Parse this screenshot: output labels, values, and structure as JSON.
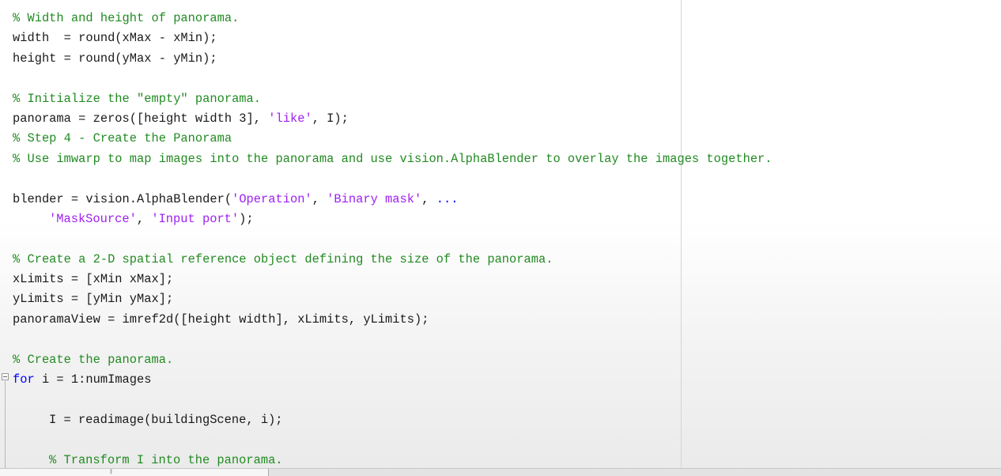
{
  "editor": {
    "lines": [
      {
        "indent": 0,
        "tokens": [
          {
            "t": "comment",
            "v": "% Width and height of panorama."
          }
        ]
      },
      {
        "indent": 0,
        "tokens": [
          {
            "t": "text",
            "v": "width  = round(xMax - xMin);"
          }
        ]
      },
      {
        "indent": 0,
        "tokens": [
          {
            "t": "text",
            "v": "height = round(yMax - yMin);"
          }
        ]
      },
      {
        "indent": 0,
        "tokens": []
      },
      {
        "indent": 0,
        "tokens": [
          {
            "t": "comment",
            "v": "% Initialize the \"empty\" panorama."
          }
        ]
      },
      {
        "indent": 0,
        "tokens": [
          {
            "t": "text",
            "v": "panorama = zeros([height width 3], "
          },
          {
            "t": "string",
            "v": "'like'"
          },
          {
            "t": "text",
            "v": ", I);"
          }
        ]
      },
      {
        "indent": 0,
        "tokens": [
          {
            "t": "comment",
            "v": "% Step 4 - Create the Panorama"
          }
        ]
      },
      {
        "indent": 0,
        "tokens": [
          {
            "t": "comment",
            "v": "% Use imwarp to map images into the panorama and use vision.AlphaBlender to overlay the images together."
          }
        ]
      },
      {
        "indent": 0,
        "tokens": []
      },
      {
        "indent": 0,
        "tokens": [
          {
            "t": "text",
            "v": "blender = vision.AlphaBlender("
          },
          {
            "t": "string",
            "v": "'Operation'"
          },
          {
            "t": "text",
            "v": ", "
          },
          {
            "t": "string",
            "v": "'Binary mask'"
          },
          {
            "t": "text",
            "v": ", "
          },
          {
            "t": "keyword",
            "v": "..."
          }
        ]
      },
      {
        "indent": 1,
        "tokens": [
          {
            "t": "string",
            "v": "'MaskSource'"
          },
          {
            "t": "text",
            "v": ", "
          },
          {
            "t": "string",
            "v": "'Input port'"
          },
          {
            "t": "text",
            "v": ");"
          }
        ]
      },
      {
        "indent": 0,
        "tokens": []
      },
      {
        "indent": 0,
        "tokens": [
          {
            "t": "comment",
            "v": "% Create a 2-D spatial reference object defining the size of the panorama."
          }
        ]
      },
      {
        "indent": 0,
        "tokens": [
          {
            "t": "text",
            "v": "xLimits = [xMin xMax];"
          }
        ]
      },
      {
        "indent": 0,
        "tokens": [
          {
            "t": "text",
            "v": "yLimits = [yMin yMax];"
          }
        ]
      },
      {
        "indent": 0,
        "tokens": [
          {
            "t": "text",
            "v": "panoramaView = imref2d([height width], xLimits, yLimits);"
          }
        ]
      },
      {
        "indent": 0,
        "tokens": []
      },
      {
        "indent": 0,
        "tokens": [
          {
            "t": "comment",
            "v": "% Create the panorama."
          }
        ]
      },
      {
        "indent": 0,
        "tokens": [
          {
            "t": "keyword",
            "v": "for"
          },
          {
            "t": "text",
            "v": " i = 1:numImages"
          }
        ]
      },
      {
        "indent": 0,
        "tokens": []
      },
      {
        "indent": 1,
        "tokens": [
          {
            "t": "text",
            "v": "I = readimage(buildingScene, i);"
          }
        ]
      },
      {
        "indent": 0,
        "tokens": []
      },
      {
        "indent": 1,
        "tokens": [
          {
            "t": "comment",
            "v": "% Transform I into the panorama."
          }
        ]
      }
    ],
    "scrollbar_grip": "‖"
  },
  "colors": {
    "comment": "#228b22",
    "keyword": "#0000ff",
    "string": "#a020f0",
    "text": "#1a1a1a"
  }
}
